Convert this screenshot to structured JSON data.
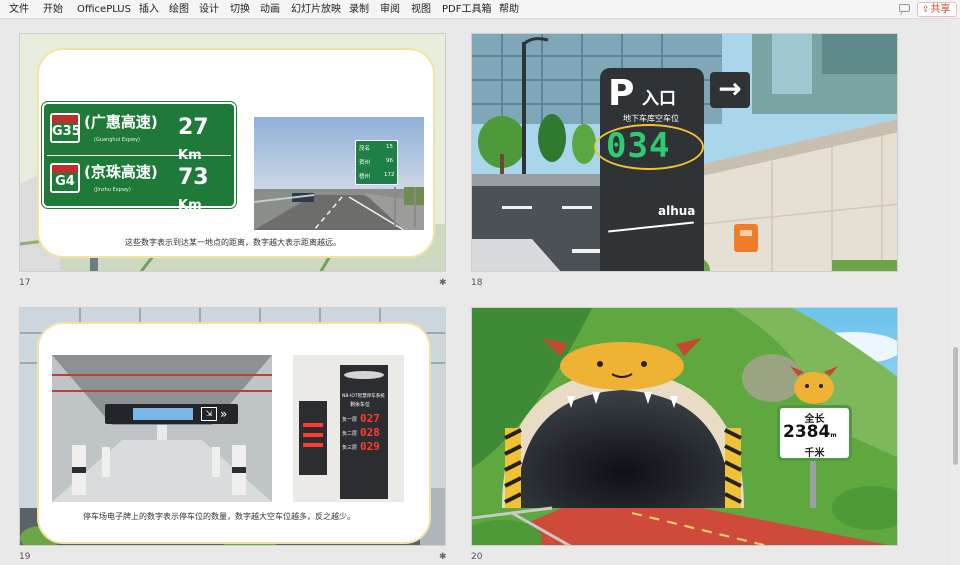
{
  "menu": {
    "items": [
      "文件",
      "开始",
      "OfficePLUS",
      "插入",
      "绘图",
      "设计",
      "切换",
      "动画",
      "幻灯片放映",
      "录制",
      "审阅",
      "视图",
      "PDF工具箱",
      "帮助"
    ],
    "share_label": "共享"
  },
  "slides": [
    {
      "number": "17",
      "sign": {
        "rows": [
          {
            "code": "G35",
            "name": "(广惠高速)",
            "name_en": "(Guanghui Expwy)",
            "distance": "27",
            "unit": "Km"
          },
          {
            "code": "G4",
            "name": "(京珠高速)",
            "name_en": "(Jinzhu Expwy)",
            "distance": "73",
            "unit": "Km"
          }
        ]
      },
      "photo_sign": [
        {
          "place": "茂名",
          "distance": "15"
        },
        {
          "place": "贺州",
          "distance": "96"
        },
        {
          "place": "梧州",
          "distance": "172"
        }
      ],
      "caption": "这些数字表示到达某一地点的距离，数字越大表示距离越远。"
    },
    {
      "number": "18",
      "parking": {
        "p_label": "P",
        "entrance": "入口",
        "subtitle": "地下车库空车位",
        "count": "034",
        "brand": "alhua",
        "arrow": "→"
      }
    },
    {
      "number": "19",
      "screen": {
        "title": "NB-IOT智慧停车系统",
        "subtitle": "剩余车位",
        "rows": [
          {
            "label": "负一层",
            "value": "027"
          },
          {
            "label": "负二层",
            "value": "028"
          },
          {
            "label": "负三层",
            "value": "029"
          }
        ]
      },
      "caption": "停车场电子牌上的数字表示停车位的数量，数字越大空车位越多，反之越少。"
    },
    {
      "number": "20",
      "tunnel_sign": {
        "label_top": "全长",
        "value": "2384",
        "unit_small": "m",
        "label_bottom": "千米"
      }
    }
  ],
  "colors": {
    "sign_green": "#1f7a3a",
    "accent_orange": "#d24726",
    "led_red": "#ff3b2f"
  }
}
